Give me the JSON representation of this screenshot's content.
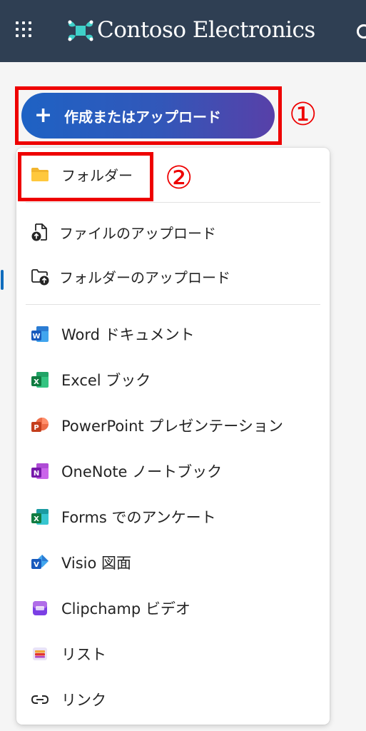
{
  "header": {
    "app_title": "Contoso Electronics",
    "background_color": "#2f3f53",
    "logo_color": "#3fd0c9",
    "icons": [
      "app-launcher-icon",
      "contoso-logo-icon",
      "settings-icon"
    ]
  },
  "create_button": {
    "plus": "+",
    "label": "作成またはアップロード"
  },
  "callouts": {
    "one": "①",
    "two": "②",
    "color": "#ee0000"
  },
  "menu": {
    "items": [
      {
        "label": "フォルダー",
        "icon": "folder-icon"
      },
      {
        "label": "ファイルのアップロード",
        "icon": "file-upload-icon"
      },
      {
        "label": "フォルダーのアップロード",
        "icon": "folder-upload-icon"
      },
      {
        "label": "Word ドキュメント",
        "icon": "word-icon"
      },
      {
        "label": "Excel ブック",
        "icon": "excel-icon"
      },
      {
        "label": "PowerPoint プレゼンテーション",
        "icon": "powerpoint-icon"
      },
      {
        "label": "OneNote ノートブック",
        "icon": "onenote-icon"
      },
      {
        "label": "Forms でのアンケート",
        "icon": "forms-icon"
      },
      {
        "label": "Visio 図面",
        "icon": "visio-icon"
      },
      {
        "label": "Clipchamp ビデオ",
        "icon": "clipchamp-icon"
      },
      {
        "label": "リスト",
        "icon": "lists-icon"
      },
      {
        "label": "リンク",
        "icon": "link-icon"
      }
    ]
  }
}
